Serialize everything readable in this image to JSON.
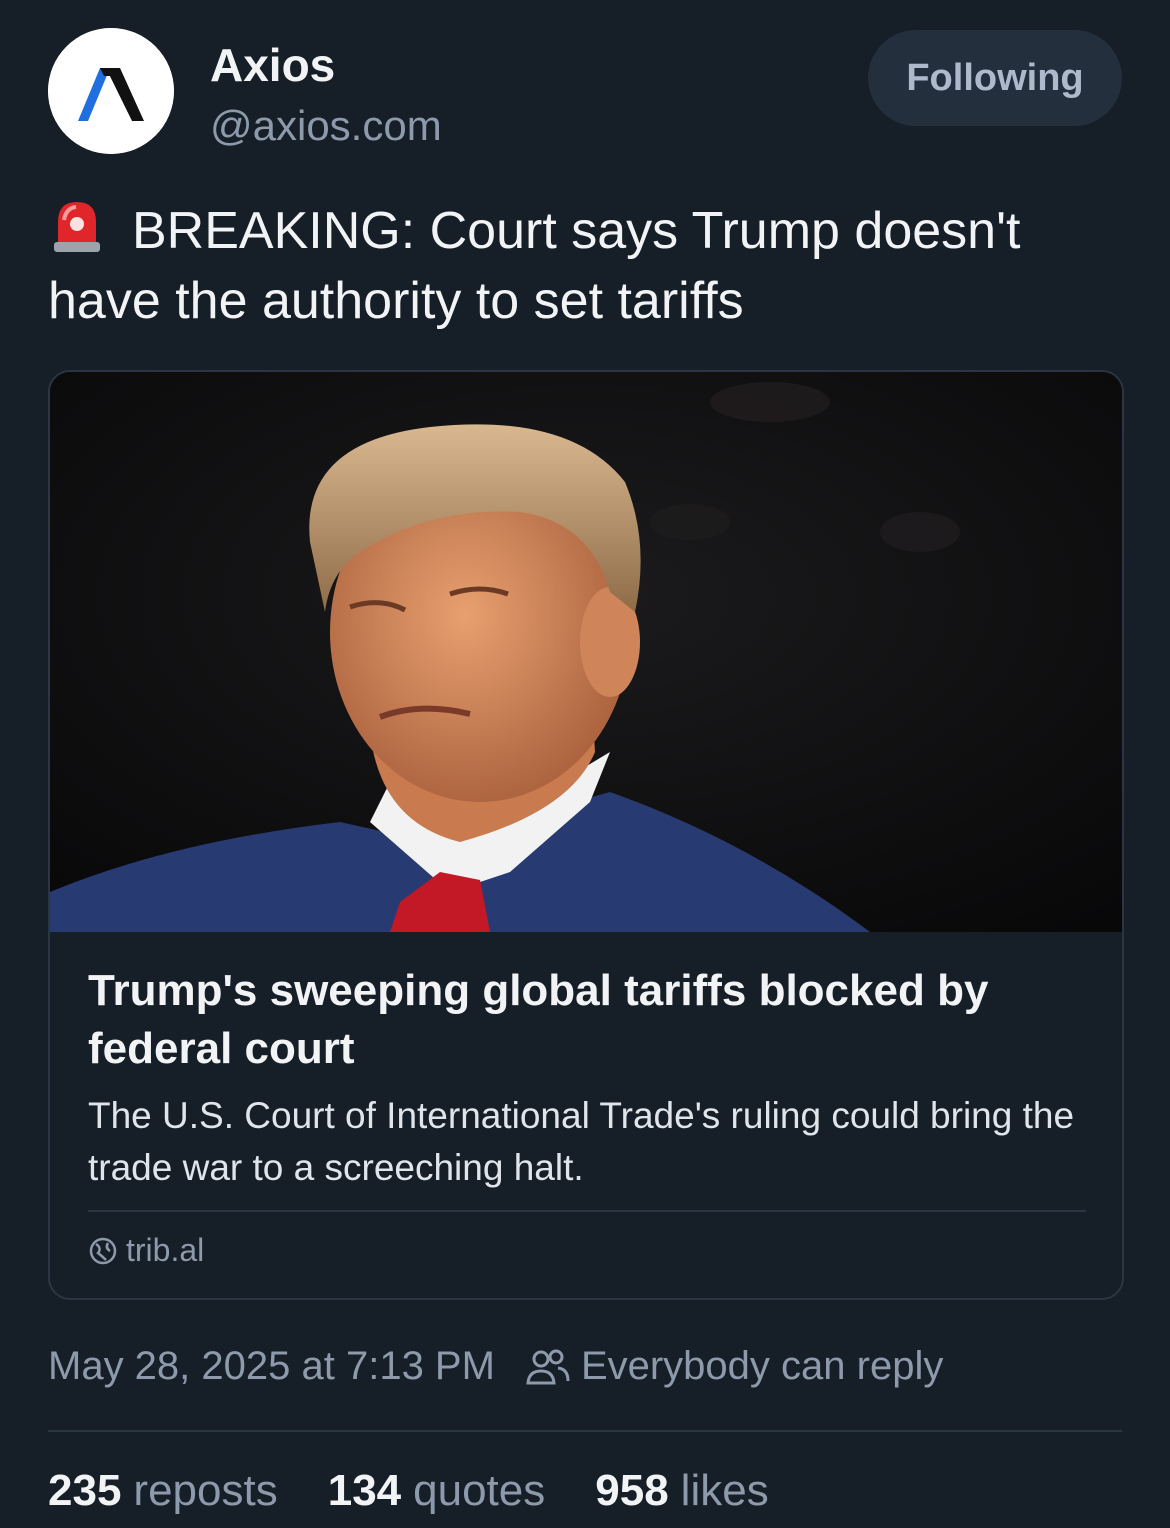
{
  "author": {
    "name": "Axios",
    "handle": "@axios.com"
  },
  "follow_button": {
    "label": "Following"
  },
  "post": {
    "emoji_icon": "rotating-light-icon",
    "text": "BREAKING: Court says Trump doesn't have the authority to set tariffs"
  },
  "link_card": {
    "title": "Trump's sweeping global tariffs blocked by federal court",
    "description": "The U.S. Court of International Trade's ruling could bring the trade war to a screeching halt.",
    "domain": "trib.al",
    "domain_icon": "globe-icon"
  },
  "meta": {
    "timestamp": "May 28, 2025 at 7:13 PM",
    "reply_setting": "Everybody can reply",
    "reply_icon": "people-icon"
  },
  "stats": {
    "reposts": {
      "count": "235",
      "label": "reposts"
    },
    "quotes": {
      "count": "134",
      "label": "quotes"
    },
    "likes": {
      "count": "958",
      "label": "likes"
    }
  },
  "colors": {
    "background": "#161e27",
    "button_bg": "#232f3c",
    "muted_text": "#8d9aab",
    "axios_blue": "#1f6fe0"
  }
}
